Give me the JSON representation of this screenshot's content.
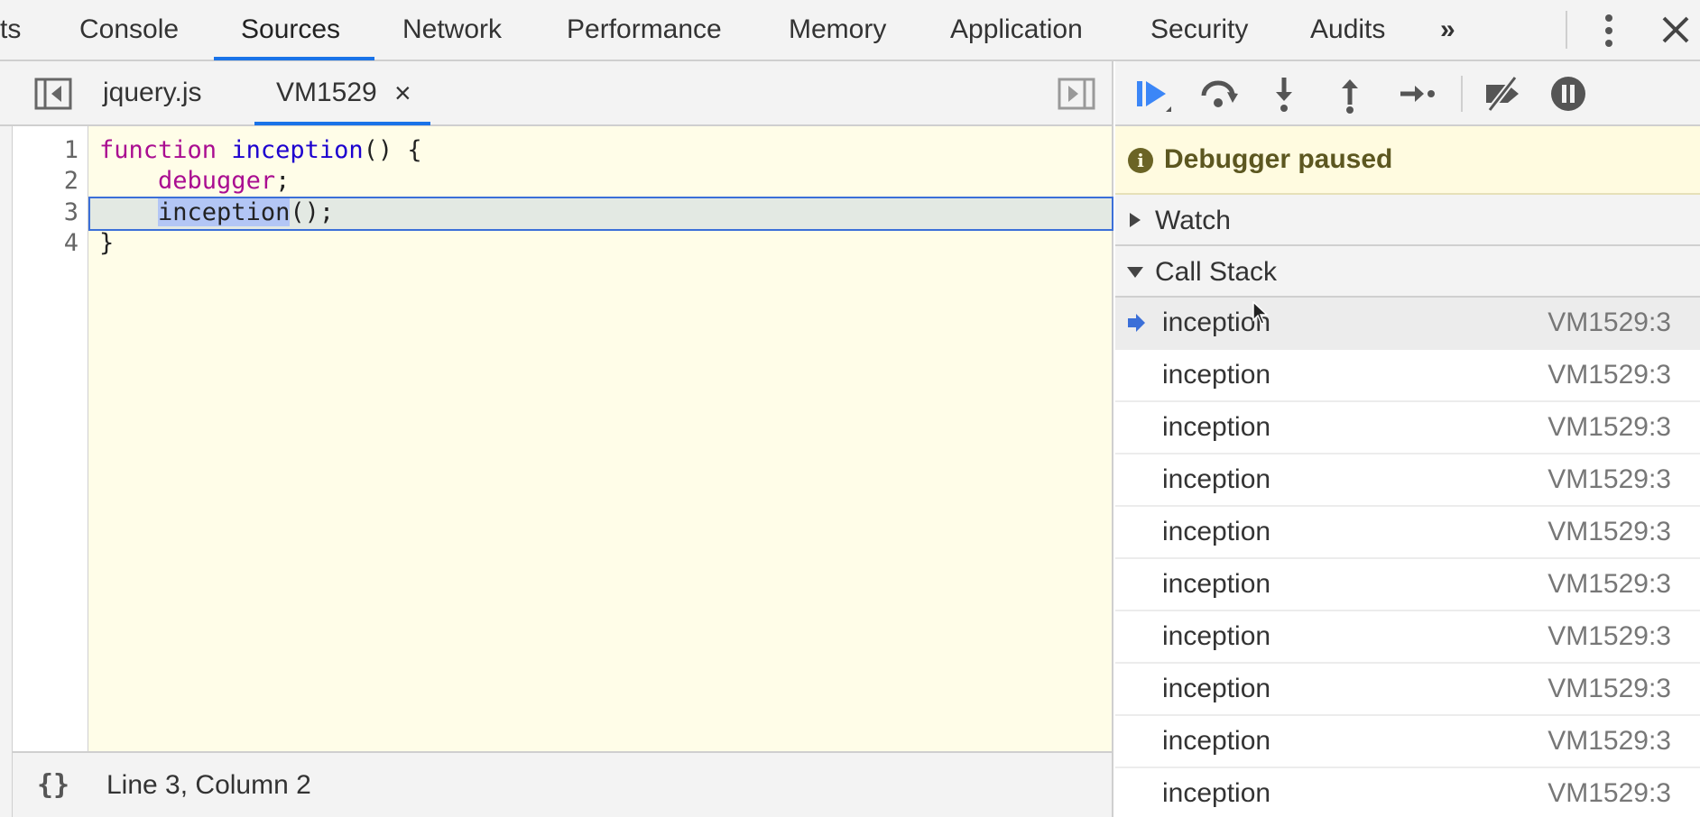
{
  "top_tabs": {
    "items": [
      "ts",
      "Console",
      "Sources",
      "Network",
      "Performance",
      "Memory",
      "Application",
      "Security",
      "Audits"
    ],
    "active": "Sources",
    "overflow_label": "»"
  },
  "editor": {
    "tabs": [
      {
        "label": "jquery.js"
      },
      {
        "label": "VM1529",
        "closable": true,
        "active": true
      }
    ],
    "close_glyph": "×",
    "line_numbers": [
      "1",
      "2",
      "3",
      "4"
    ],
    "code": {
      "l1_kw": "function",
      "l1_fn": "inception",
      "l1_rest": "() {",
      "l2_indent": "    ",
      "l2_kw": "debugger",
      "l2_rest": ";",
      "l3_indent": "    ",
      "l3_sel": "inception",
      "l3_rest": "();",
      "l4": "}"
    },
    "paused_line": 3
  },
  "statusbar": {
    "pretty_print_glyph": "{}",
    "position": "Line 3, Column 2"
  },
  "debugger": {
    "paused_message": "Debugger paused",
    "info_glyph": "i",
    "sections": {
      "watch": "Watch",
      "call_stack": "Call Stack"
    },
    "call_stack": [
      {
        "fn": "inception",
        "loc": "VM1529:3",
        "current": true
      },
      {
        "fn": "inception",
        "loc": "VM1529:3"
      },
      {
        "fn": "inception",
        "loc": "VM1529:3"
      },
      {
        "fn": "inception",
        "loc": "VM1529:3"
      },
      {
        "fn": "inception",
        "loc": "VM1529:3"
      },
      {
        "fn": "inception",
        "loc": "VM1529:3"
      },
      {
        "fn": "inception",
        "loc": "VM1529:3"
      },
      {
        "fn": "inception",
        "loc": "VM1529:3"
      },
      {
        "fn": "inception",
        "loc": "VM1529:3"
      },
      {
        "fn": "inception",
        "loc": "VM1529:3"
      }
    ]
  },
  "colors": {
    "accent": "#1a73e8",
    "resume_blue": "#3b86f7",
    "paused_banner": "#fffbe0",
    "code_bg": "#fffde8",
    "keyword": "#aa0d91",
    "function_name": "#1c00cf"
  },
  "icons": [
    "toggle-navigator-icon",
    "toggle-debugger-icon",
    "resume-icon",
    "step-over-icon",
    "step-into-icon",
    "step-out-icon",
    "step-icon",
    "deactivate-breakpoints-icon",
    "pause-on-exceptions-icon",
    "more-vertical-icon",
    "close-devtools-icon",
    "info-icon",
    "current-frame-arrow-icon",
    "mouse-cursor-icon"
  ]
}
